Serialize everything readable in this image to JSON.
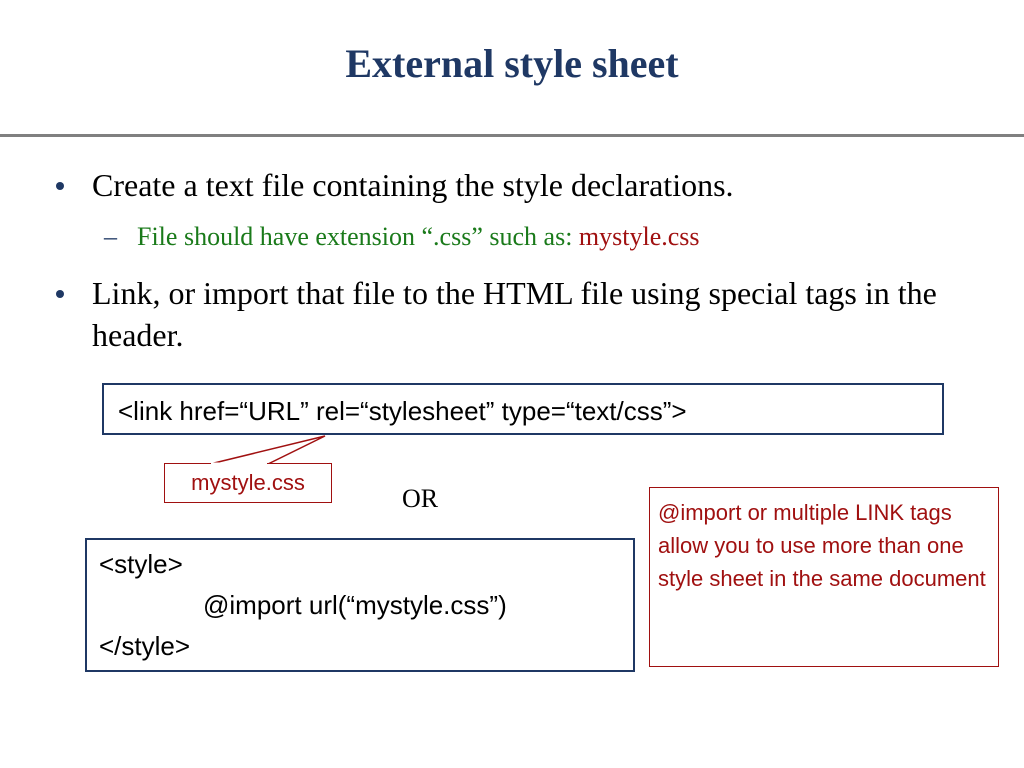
{
  "slide": {
    "title": "External style sheet",
    "bullets": [
      {
        "text": "Create a text file containing the style declarations.",
        "sub": {
          "text": "File should have extension “.css” such as: ",
          "highlight": "mystyle.css"
        }
      },
      {
        "text": "Link, or import that file to the HTML file using special tags in the header."
      }
    ],
    "link_code": "<link href=“URL” rel=“stylesheet” type=“text/css”>",
    "callout": "mystyle.css",
    "or_label": "OR",
    "style_code": {
      "line1": "<style>",
      "line2": "@import url(“mystyle.css”)",
      "line3": "</style>"
    },
    "note": "@import or multiple LINK tags allow you to use more than one style sheet in the same document"
  },
  "colors": {
    "title": "#1f3864",
    "sub_text": "#1a7a1a",
    "highlight": "#a01010",
    "box_border": "#1f3864",
    "callout": "#a01010"
  }
}
